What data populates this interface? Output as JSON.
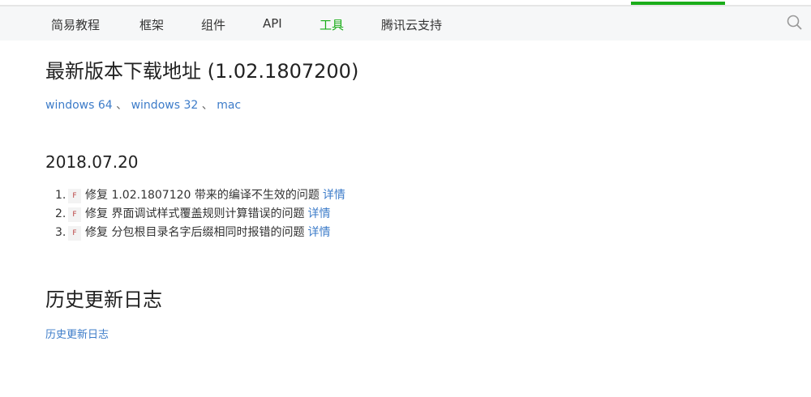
{
  "nav": {
    "items": [
      "简易教程",
      "框架",
      "组件",
      "API",
      "工具",
      "腾讯云支持"
    ],
    "active": "工具"
  },
  "download": {
    "title": "最新版本下载地址 (1.02.1807200)",
    "links": [
      "windows 64",
      "windows 32",
      "mac"
    ],
    "sep": "、"
  },
  "release": {
    "date": "2018.07.20",
    "items": [
      {
        "num": "1.",
        "tag": "F",
        "text": "修复 1.02.1807120 带来的编译不生效的问题",
        "link": "详情"
      },
      {
        "num": "2.",
        "tag": "F",
        "text": "修复 界面调试样式覆盖规则计算错误的问题",
        "link": "详情"
      },
      {
        "num": "3.",
        "tag": "F",
        "text": "修复 分包根目录名字后缀相同时报错的问题",
        "link": "详情"
      }
    ]
  },
  "history": {
    "title": "历史更新日志",
    "link": "历史更新日志"
  }
}
